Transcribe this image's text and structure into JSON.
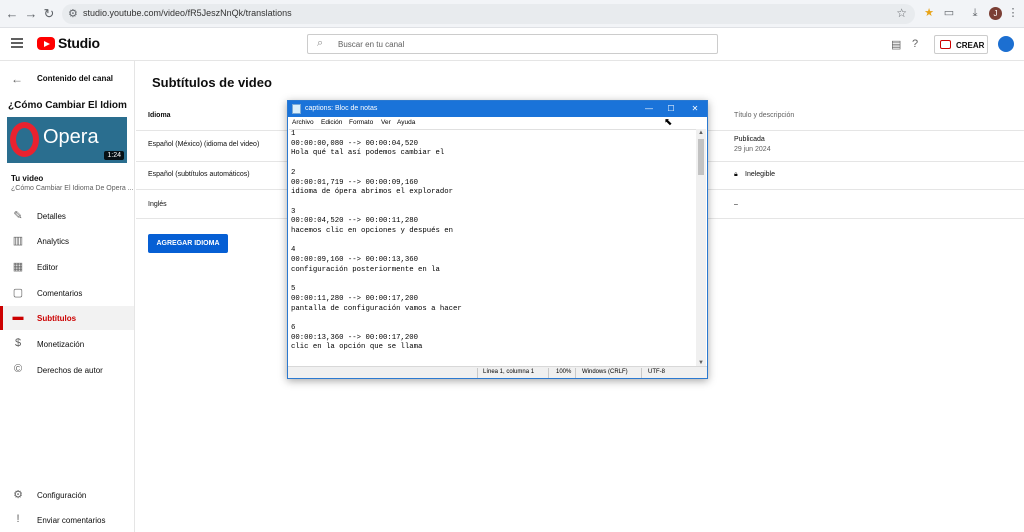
{
  "browser": {
    "url": "studio.youtube.com/video/fR5JeszNnQk/translations",
    "profile_initial": "J"
  },
  "header": {
    "brand": "Studio",
    "search_placeholder": "Buscar en tu canal",
    "create_label": "CREAR"
  },
  "sidebar": {
    "back_label": "Contenido del canal",
    "thumbnail": {
      "title_text": "¿Cómo Cambiar El Idioma?",
      "brand_text": "Opera",
      "duration": "1:24"
    },
    "your_video_label": "Tu video",
    "video_title": "¿Cómo Cambiar El Idioma De Opera ...",
    "items": [
      {
        "label": "Detalles",
        "icon": "pencil-icon"
      },
      {
        "label": "Analytics",
        "icon": "analytics-icon"
      },
      {
        "label": "Editor",
        "icon": "editor-icon"
      },
      {
        "label": "Comentarios",
        "icon": "comments-icon"
      },
      {
        "label": "Subtítulos",
        "icon": "subtitles-icon"
      },
      {
        "label": "Monetización",
        "icon": "dollar-icon"
      },
      {
        "label": "Derechos de autor",
        "icon": "copyright-icon"
      }
    ],
    "bottom_items": [
      {
        "label": "Configuración",
        "icon": "gear-icon"
      },
      {
        "label": "Enviar comentarios",
        "icon": "feedback-icon"
      }
    ]
  },
  "main": {
    "page_title": "Subtítulos de video",
    "columns": {
      "language": "Idioma",
      "title_desc": "Título y descripción"
    },
    "rows": [
      {
        "language": "Español (México) (idioma del video)",
        "status": "Publicada",
        "date": "29 jun 2024"
      },
      {
        "language": "Español (subtítulos automáticos)",
        "status": "Inelegible",
        "date": ""
      },
      {
        "language": "Inglés",
        "status": "–",
        "date": ""
      }
    ],
    "add_button": "AGREGAR IDIOMA"
  },
  "notepad": {
    "title": "captions: Bloc de notas",
    "menu": [
      "Archivo",
      "Edición",
      "Formato",
      "Ver",
      "Ayuda"
    ],
    "content": "1\n00:00:00,080 --> 00:00:04,520\nHola qué tal así podemos cambiar el\n\n2\n00:00:01,719 --> 00:00:09,160\nidioma de ópera abrimos el explorador\n\n3\n00:00:04,520 --> 00:00:11,280\nhacemos clic en opciones y después en\n\n4\n00:00:09,160 --> 00:00:13,360\nconfiguración posteriormente en la\n\n5\n00:00:11,280 --> 00:00:17,200\npantalla de configuración vamos a hacer\n\n6\n00:00:13,360 --> 00:00:17,200\nclic en la opción que se llama",
    "status": {
      "position": "Línea 1, columna 1",
      "zoom": "100%",
      "eol": "Windows (CRLF)",
      "encoding": "UTF-8"
    }
  }
}
